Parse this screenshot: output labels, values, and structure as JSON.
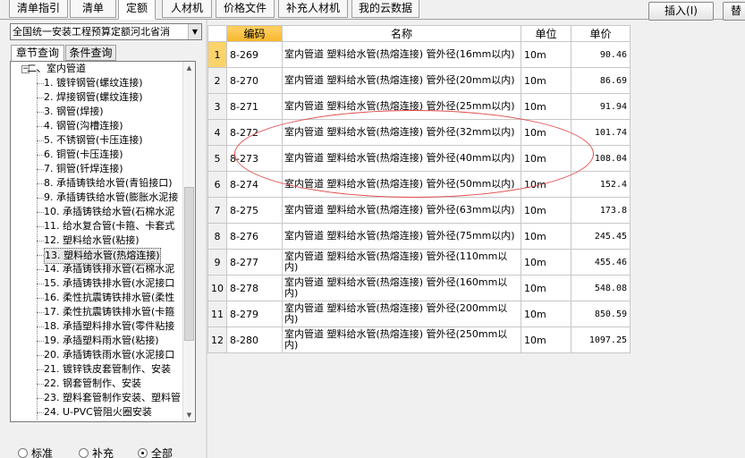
{
  "top_tabs": [
    "清单指引",
    "清单",
    "定额",
    "人材机",
    "价格文件",
    "补充人材机",
    "我的云数据"
  ],
  "active_top_tab": "定额",
  "buttons": {
    "insert": "插入(I)",
    "replace": "替"
  },
  "left_panel": {
    "combo_value": "全国统一安装工程预算定额河北省消",
    "tabs": [
      "章节查询",
      "条件查询"
    ],
    "tree_root": "二、室内管道",
    "tree_items": [
      "1. 镀锌钢管(螺纹连接)",
      "2. 焊接钢管(螺纹连接)",
      "3. 钢管(焊接)",
      "4. 钢管(沟槽连接)",
      "5. 不锈钢管(卡压连接)",
      "6. 铜管(卡压连接)",
      "7. 铜管(钎焊连接)",
      "8. 承插铸铁给水管(青铅接口)",
      "9. 承插铸铁给水管(膨胀水泥接",
      "10. 承插铸铁给水管(石棉水泥",
      "11. 给水复合管(卡箍、卡套式",
      "12. 塑料给水管(粘接)",
      "13. 塑料给水管(热熔连接)",
      "14. 承插铸铁排水管(石棉水泥",
      "15. 承插铸铁排水管(水泥接口",
      "16. 柔性抗震铸铁排水管(柔性",
      "17. 柔性抗震铸铁排水管(卡箍",
      "18. 承插塑料排水管(零件粘接",
      "19. 承插塑料雨水管(粘接)",
      "20. 承插铸铁雨水管(水泥接口",
      "21. 镀锌铁皮套管制作、安装",
      "22. 钢套管制作、安装",
      "23. 塑料套管制作安装、塑料管",
      "24. U-PVC管阻火圈安装"
    ],
    "selected_index": 12,
    "radios": [
      "标准",
      "补充",
      "全部"
    ],
    "radio_selected": "全部"
  },
  "grid": {
    "headers": {
      "row": "",
      "code": "编码",
      "name": "名称",
      "unit": "单位",
      "price": "单价"
    },
    "rows": [
      {
        "n": "1",
        "code": "8-269",
        "name": "室内管道 塑料给水管(热熔连接) 管外径(16mm以内)",
        "unit": "10m",
        "price": "90.46"
      },
      {
        "n": "2",
        "code": "8-270",
        "name": "室内管道 塑料给水管(热熔连接) 管外径(20mm以内)",
        "unit": "10m",
        "price": "86.69"
      },
      {
        "n": "3",
        "code": "8-271",
        "name": "室内管道 塑料给水管(热熔连接) 管外径(25mm以内)",
        "unit": "10m",
        "price": "91.94"
      },
      {
        "n": "4",
        "code": "8-272",
        "name": "室内管道 塑料给水管(热熔连接) 管外径(32mm以内)",
        "unit": "10m",
        "price": "101.74"
      },
      {
        "n": "5",
        "code": "8-273",
        "name": "室内管道 塑料给水管(热熔连接) 管外径(40mm以内)",
        "unit": "10m",
        "price": "108.04"
      },
      {
        "n": "6",
        "code": "8-274",
        "name": "室内管道 塑料给水管(热熔连接) 管外径(50mm以内)",
        "unit": "10m",
        "price": "152.4"
      },
      {
        "n": "7",
        "code": "8-275",
        "name": "室内管道 塑料给水管(热熔连接) 管外径(63mm以内)",
        "unit": "10m",
        "price": "173.8"
      },
      {
        "n": "8",
        "code": "8-276",
        "name": "室内管道 塑料给水管(热熔连接) 管外径(75mm以内)",
        "unit": "10m",
        "price": "245.45"
      },
      {
        "n": "9",
        "code": "8-277",
        "name": "室内管道 塑料给水管(热熔连接) 管外径(110mm以内)",
        "unit": "10m",
        "price": "455.46"
      },
      {
        "n": "10",
        "code": "8-278",
        "name": "室内管道 塑料给水管(热熔连接) 管外径(160mm以内)",
        "unit": "10m",
        "price": "548.08"
      },
      {
        "n": "11",
        "code": "8-279",
        "name": "室内管道 塑料给水管(热熔连接) 管外径(200mm以内)",
        "unit": "10m",
        "price": "850.59"
      },
      {
        "n": "12",
        "code": "8-280",
        "name": "室内管道 塑料给水管(热熔连接) 管外径(250mm以内)",
        "unit": "10m",
        "price": "1097.25"
      }
    ],
    "selected_row": 0
  },
  "colors": {
    "header_accent": "#f7b62a",
    "annotation": "#e04b4b",
    "selection": "#fbd36a"
  }
}
